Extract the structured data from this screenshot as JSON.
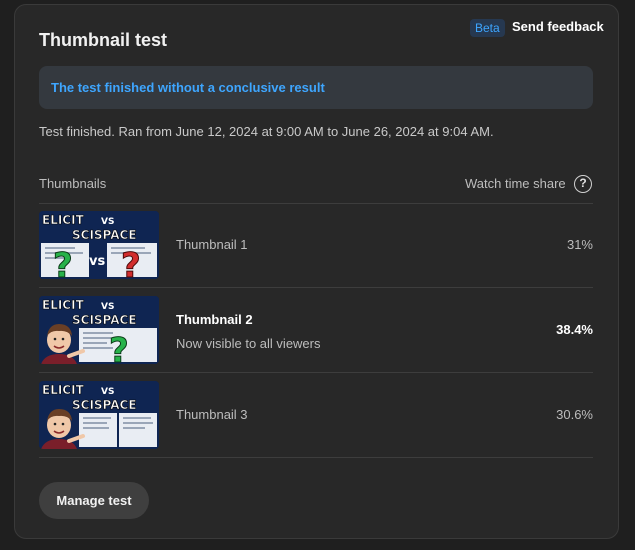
{
  "header": {
    "title": "Thumbnail test",
    "beta_label": "Beta",
    "feedback_label": "Send feedback"
  },
  "banner": {
    "text": "The test finished without a conclusive result"
  },
  "meta": {
    "text": "Test finished. Ran from June 12, 2024 at 9:00 AM to June 26, 2024 at 9:04 AM."
  },
  "table": {
    "col_thumbnails": "Thumbnails",
    "col_share": "Watch time share",
    "help_icon": "?",
    "rows": [
      {
        "name": "Thumbnail 1",
        "subtitle": "",
        "share": "31%",
        "thumb_text": [
          "ELICIT",
          "VS",
          "SCISPACE"
        ],
        "thumb_icons": [
          "question-mark-green",
          "vs",
          "question-mark-red"
        ]
      },
      {
        "name": "Thumbnail 2",
        "subtitle": "Now visible to all viewers",
        "share": "38.4%",
        "thumb_text": [
          "ELICIT",
          "VS",
          "SCISPACE"
        ],
        "thumb_icons": [
          "person-pointing",
          "question-mark-green"
        ]
      },
      {
        "name": "Thumbnail 3",
        "subtitle": "",
        "share": "30.6%",
        "thumb_text": [
          "ELICIT",
          "VS",
          "SCISPACE"
        ],
        "thumb_icons": [
          "person-pointing",
          "screenshots"
        ]
      }
    ]
  },
  "footer": {
    "manage_label": "Manage test"
  },
  "colors": {
    "accent": "#3ea6ff",
    "background": "#1f1f1f",
    "card": "#282828",
    "banner": "#34393f",
    "thumb_bg": "#0f2552",
    "green_question": "#27b24a",
    "red_question": "#d22d2d"
  }
}
